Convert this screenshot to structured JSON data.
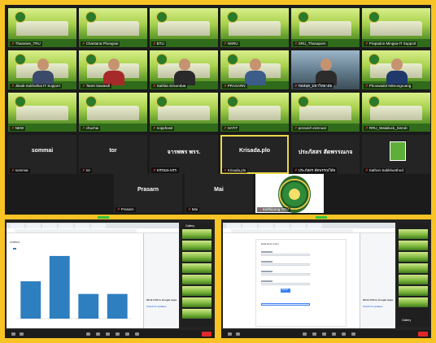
{
  "gallery": {
    "tiles": [
      {
        "name": "Tharanee_TRU",
        "kind": "bg"
      },
      {
        "name": "Chantana Phongsai",
        "kind": "bg"
      },
      {
        "name": "BTU",
        "kind": "bg"
      },
      {
        "name": "NSRU",
        "kind": "bg"
      },
      {
        "name": "SRU_Thanaporn",
        "kind": "bg"
      },
      {
        "name": "Prapadon Mingsa-IT Support",
        "kind": "bg"
      },
      {
        "name": "Jitsak-Sukhothai IT Support",
        "kind": "person"
      },
      {
        "name": "Tanet Sawasdi",
        "kind": "person"
      },
      {
        "name": "Sathita Srisombat",
        "kind": "person"
      },
      {
        "name": "PRASARN",
        "kind": "person"
      },
      {
        "name": "หอสมุด_มหาวิทยาลัย",
        "kind": "room"
      },
      {
        "name": "Phoowadol Nilmongruang",
        "kind": "person"
      },
      {
        "name": "NEW",
        "kind": "bg"
      },
      {
        "name": "chuchai",
        "kind": "bg"
      },
      {
        "name": "nopphasit",
        "kind": "bg"
      },
      {
        "name": "SATIT",
        "kind": "bg"
      },
      {
        "name": "peravich.nimnual",
        "kind": "bg"
      },
      {
        "name": "RRU_Walailuck_Sinrub",
        "kind": "bg"
      },
      {
        "name": "sommai",
        "label": "sommai",
        "kind": "dark"
      },
      {
        "name": "tor",
        "label": "tor",
        "kind": "dark"
      },
      {
        "name": "พรรณพ พรร.",
        "label": "จารพพร พรร.",
        "kind": "dark"
      },
      {
        "name": "Krisada.plo",
        "label": "Krisada.plo",
        "kind": "dark"
      },
      {
        "name": "ประภัสสร สัตพรรณวิสัย",
        "label": "ประภัสสร สัตพรรณกจ",
        "kind": "dark"
      },
      {
        "name": "Sathon Sabkhunthod",
        "kind": "card"
      },
      {
        "name": "Prasarn",
        "label": "Prasarn",
        "kind": "dark"
      },
      {
        "name": "Mai",
        "label": "Mai",
        "kind": "dark"
      },
      {
        "name": "Sutthipong TRU",
        "kind": "logo"
      }
    ]
  },
  "left_share": {
    "tab_label": "Untitled",
    "chart_data": {
      "type": "bar",
      "categories": [
        "",
        "",
        "",
        ""
      ],
      "values": [
        56,
        94,
        37,
        37
      ],
      "ylim": [
        0,
        100
      ]
    },
    "panel_label": "Gallery",
    "devtools_heading": "Work CSS in Google Apps",
    "devtools_link": "Check for updates"
  },
  "right_share": {
    "tab_label": "Data Entry Form",
    "form_button": "Submit",
    "panel_label": "Gallery",
    "devtools_heading": "Work CSS in Google Apps",
    "devtools_link": "Check for updates"
  },
  "colors": {
    "frame": "#f7c325",
    "bar": "#2e7fbf",
    "active_speaker": "#e8d84a",
    "leave_button": "#e02828"
  }
}
